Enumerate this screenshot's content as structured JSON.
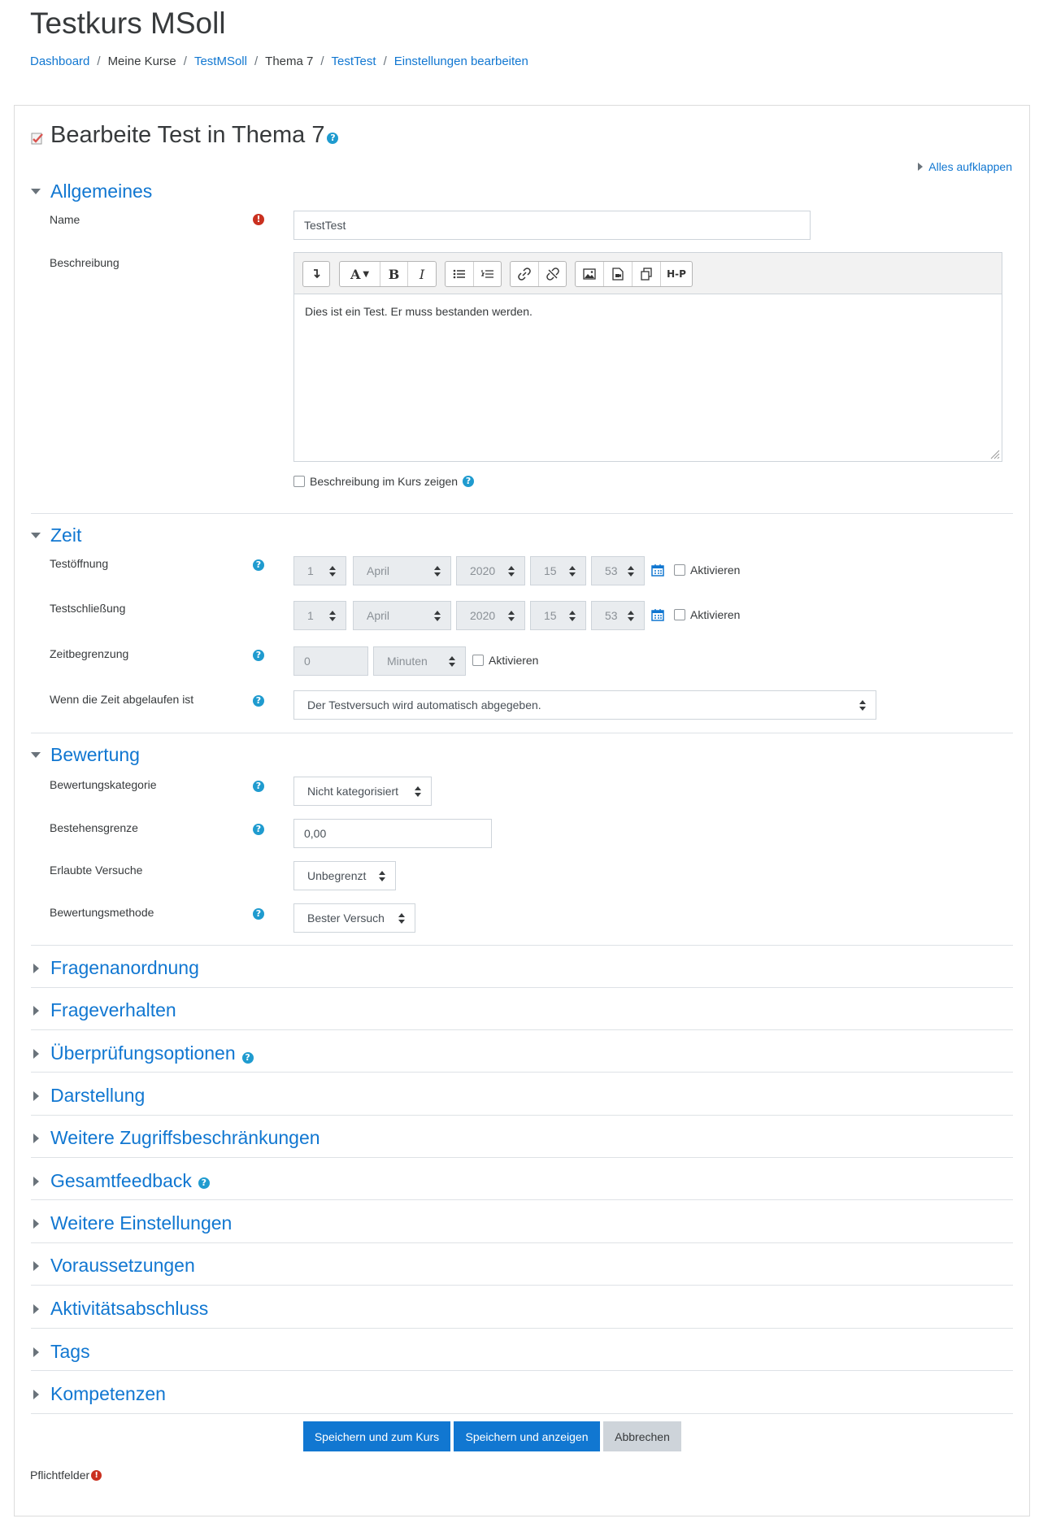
{
  "course": {
    "title": "Testkurs MSoll"
  },
  "breadcrumb": [
    {
      "label": "Dashboard",
      "link": true
    },
    {
      "label": "Meine Kurse",
      "link": false
    },
    {
      "label": "TestMSoll",
      "link": true
    },
    {
      "label": "Thema 7",
      "link": false
    },
    {
      "label": "TestTest",
      "link": true
    },
    {
      "label": "Einstellungen bearbeiten",
      "link": true
    }
  ],
  "page": {
    "heading": "Bearbeite Test in Thema 7",
    "expand_all": "Alles aufklappen"
  },
  "sections": {
    "general": "Allgemeines",
    "timing": "Zeit",
    "grade": "Bewertung",
    "collapsed": [
      "Fragenanordnung",
      "Frageverhalten",
      "Überprüfungsoptionen",
      "Darstellung",
      "Weitere Zugriffsbeschränkungen",
      "Gesamtfeedback",
      "Weitere Einstellungen",
      "Voraussetzungen",
      "Aktivitätsabschluss",
      "Tags",
      "Kompetenzen"
    ]
  },
  "general": {
    "name_label": "Name",
    "name_value": "TestTest",
    "description_label": "Beschreibung",
    "description_text": "Dies ist ein Test. Er muss bestanden werden.",
    "show_description_label": "Beschreibung im Kurs zeigen",
    "toolbar": {
      "font_label": "A",
      "bold": "B",
      "italic": "I",
      "h5p": "H-P"
    }
  },
  "timing": {
    "open_label": "Testöffnung",
    "close_label": "Testschließung",
    "open": {
      "day": "1",
      "month": "April",
      "year": "2020",
      "hour": "15",
      "minute": "53"
    },
    "close": {
      "day": "1",
      "month": "April",
      "year": "2020",
      "hour": "15",
      "minute": "53"
    },
    "enable_label": "Aktivieren",
    "limit_label": "Zeitbegrenzung",
    "limit_value": "0",
    "limit_unit": "Minuten",
    "overdue_label": "Wenn die Zeit abgelaufen ist",
    "overdue_value": "Der Testversuch wird automatisch abgegeben."
  },
  "grade": {
    "category_label": "Bewertungskategorie",
    "category_value": "Nicht kategorisiert",
    "pass_label": "Bestehensgrenze",
    "pass_value": "0,00",
    "attempts_label": "Erlaubte Versuche",
    "attempts_value": "Unbegrenzt",
    "method_label": "Bewertungsmethode",
    "method_value": "Bester Versuch"
  },
  "buttons": {
    "save_return": "Speichern und zum Kurs",
    "save_display": "Speichern und anzeigen",
    "cancel": "Abbrechen"
  },
  "required_note": "Pflichtfelder",
  "colors": {
    "link": "#1177d1",
    "help": "#1f9bcf",
    "required": "#ca3120",
    "primary_button": "#1177d1"
  }
}
